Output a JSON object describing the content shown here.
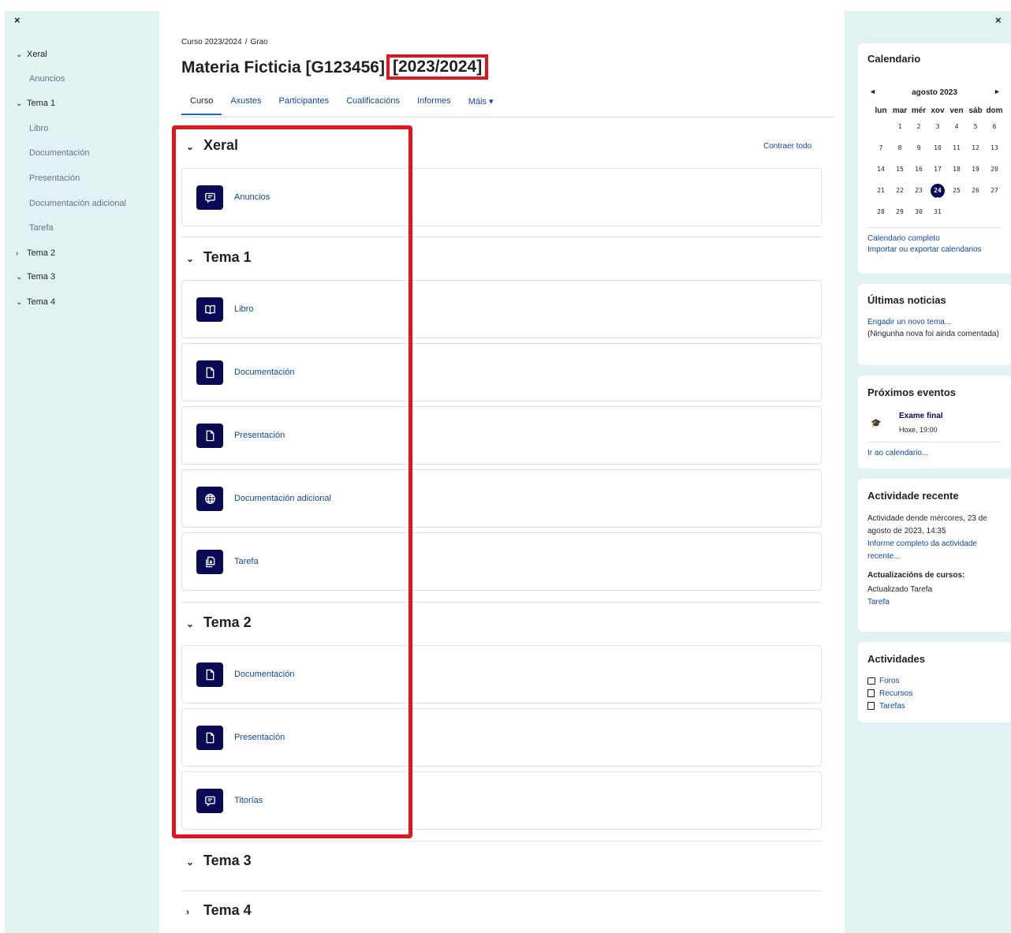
{
  "left_drawer": {
    "close": "×",
    "items": [
      {
        "label": "Xeral",
        "chevron": "⌄",
        "type": "section"
      },
      {
        "label": "Anuncios",
        "type": "activity"
      },
      {
        "label": "Tema 1",
        "chevron": "⌄",
        "type": "section"
      },
      {
        "label": "Libro",
        "type": "activity"
      },
      {
        "label": "Documentación",
        "type": "activity"
      },
      {
        "label": "Presentación",
        "type": "activity"
      },
      {
        "label": "Documentación adicional",
        "type": "activity"
      },
      {
        "label": "Tarefa",
        "type": "activity"
      },
      {
        "label": "Tema 2",
        "chevron": "›",
        "type": "section"
      },
      {
        "label": "Tema 3",
        "chevron": "⌄",
        "type": "section"
      },
      {
        "label": "Tema 4",
        "chevron": "⌄",
        "type": "section"
      }
    ]
  },
  "breadcrumb": {
    "first": "Curso 2023/2024",
    "sep": "/",
    "second": "Grao"
  },
  "page_title": {
    "main": "Materia Ficticia [G123456]",
    "year": "[2023/2024]"
  },
  "tabs": [
    {
      "label": "Curso",
      "active": true
    },
    {
      "label": "Axustes"
    },
    {
      "label": "Participantes"
    },
    {
      "label": "Cualificacións"
    },
    {
      "label": "Informes"
    },
    {
      "label": "Máis ▾"
    }
  ],
  "collapse_all": "Contraer todo",
  "sections": [
    {
      "title": "Xeral",
      "chevron": "⌄",
      "activities": [
        {
          "name": "Anuncios",
          "icon": "forum-icon"
        }
      ]
    },
    {
      "title": "Tema 1",
      "chevron": "⌄",
      "activities": [
        {
          "name": "Libro",
          "icon": "book-icon"
        },
        {
          "name": "Documentación",
          "icon": "file-icon"
        },
        {
          "name": "Presentación",
          "icon": "file-icon"
        },
        {
          "name": "Documentación adicional",
          "icon": "globe-icon"
        },
        {
          "name": "Tarefa",
          "icon": "assignment-icon"
        }
      ]
    },
    {
      "title": "Tema 2",
      "chevron": "⌄",
      "activities": [
        {
          "name": "Documentación",
          "icon": "file-icon"
        },
        {
          "name": "Presentación",
          "icon": "file-icon"
        },
        {
          "name": "Titorías",
          "icon": "forum-icon"
        }
      ]
    },
    {
      "title": "Tema 3",
      "chevron": "⌄",
      "activities": []
    },
    {
      "title": "Tema 4",
      "chevron": "›",
      "activities": []
    }
  ],
  "right_drawer": {
    "close": "×",
    "calendar": {
      "title": "Calendario",
      "prev": "◄",
      "next": "►",
      "month": "agosto 2023",
      "weekdays": [
        "lun",
        "mar",
        "mér",
        "xov",
        "ven",
        "sáb",
        "dom"
      ],
      "weeks": [
        [
          "",
          "1",
          "2",
          "3",
          "4",
          "5",
          "6"
        ],
        [
          "7",
          "8",
          "9",
          "10",
          "11",
          "12",
          "13"
        ],
        [
          "14",
          "15",
          "16",
          "17",
          "18",
          "19",
          "20"
        ],
        [
          "21",
          "22",
          "23",
          "24",
          "25",
          "26",
          "27"
        ],
        [
          "28",
          "29",
          "30",
          "31",
          "",
          "",
          ""
        ]
      ],
      "today": "24",
      "full_link": "Calendario completo",
      "import_link": "Importar ou exportar calendarios"
    },
    "news": {
      "title": "Últimas noticias",
      "add_link": "Engadir un novo tema...",
      "empty": "(Ningunha nova foi ainda comentada)"
    },
    "events": {
      "title": "Próximos eventos",
      "event_name": "Exame final",
      "event_time": "Hoxe, 19:00",
      "goto_link": "Ir ao calendario..."
    },
    "recent": {
      "title": "Actividade recente",
      "since": "Actividade dende mércores, 23 de agosto de 2023, 14:35",
      "full_report": "Informe completo da actividade recente...",
      "updates_title": "Actualizacións de cursos:",
      "updated_text": "Actualizado Tarefa",
      "updated_link": "Tarefa"
    },
    "activities": {
      "title": "Actividades",
      "items": [
        {
          "label": "Foros",
          "icon": "forum-small-icon"
        },
        {
          "label": "Recursos",
          "icon": "resource-small-icon"
        },
        {
          "label": "Tarefas",
          "icon": "assignment-small-icon"
        }
      ]
    }
  },
  "colors": {
    "accent": "#0a0a57",
    "link": "#0f47ad",
    "highlight": "#e3141e",
    "drawer_bg": "#e0f2f1"
  }
}
